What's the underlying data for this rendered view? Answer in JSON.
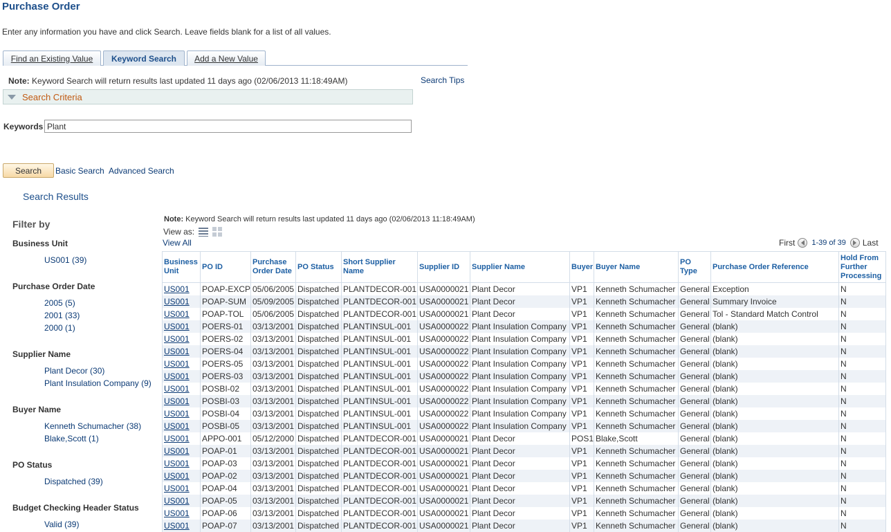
{
  "page": {
    "title": "Purchase Order",
    "instructions": "Enter any information you have and click Search. Leave fields blank for a list of all values."
  },
  "tabs": [
    {
      "label": "Find an Existing Value"
    },
    {
      "label": "Keyword Search"
    },
    {
      "label": "Add a New Value"
    }
  ],
  "note": {
    "label": "Note:",
    "text": "Keyword Search will return results last updated 11 days ago (02/06/2013 11:18:49AM)"
  },
  "search_tips": "Search Tips",
  "criteria": {
    "label": "Search Criteria"
  },
  "keywords": {
    "label": "Keywords",
    "value": "Plant"
  },
  "buttons": {
    "search": "Search",
    "basic_search": "Basic Search",
    "advanced_search": "Advanced Search"
  },
  "results": {
    "title": "Search Results",
    "note_label": "Note:",
    "note_text": "Keyword Search will return results last updated 11 days ago (02/06/2013 11:18:49AM)",
    "view_as": "View as:",
    "view_all": "View All",
    "pager": {
      "first": "First",
      "range": "1-39 of 39",
      "last": "Last"
    },
    "columns": [
      "Business Unit",
      "PO ID",
      "Purchase Order Date",
      "PO Status",
      "Short Supplier Name",
      "Supplier ID",
      "Supplier Name",
      "Buyer",
      "Buyer Name",
      "PO Type",
      "Purchase Order Reference",
      "Hold From Further Processing"
    ],
    "rows": [
      [
        "US001",
        "POAP-EXCP",
        "05/06/2005",
        "Dispatched",
        "PLANTDECOR-001",
        "USA0000021",
        "Plant Decor",
        "VP1",
        "Kenneth Schumacher",
        "General",
        "Exception",
        "N"
      ],
      [
        "US001",
        "POAP-SUM",
        "05/09/2005",
        "Dispatched",
        "PLANTDECOR-001",
        "USA0000021",
        "Plant Decor",
        "VP1",
        "Kenneth Schumacher",
        "General",
        "Summary Invoice",
        "N"
      ],
      [
        "US001",
        "POAP-TOL",
        "05/06/2005",
        "Dispatched",
        "PLANTDECOR-001",
        "USA0000021",
        "Plant Decor",
        "VP1",
        "Kenneth Schumacher",
        "General",
        "Tol - Standard Match Control",
        "N"
      ],
      [
        "US001",
        "POERS-01",
        "03/13/2001",
        "Dispatched",
        "PLANTINSUL-001",
        "USA0000022",
        "Plant Insulation Company",
        "VP1",
        "Kenneth Schumacher",
        "General",
        "(blank)",
        "N"
      ],
      [
        "US001",
        "POERS-02",
        "03/13/2001",
        "Dispatched",
        "PLANTINSUL-001",
        "USA0000022",
        "Plant Insulation Company",
        "VP1",
        "Kenneth Schumacher",
        "General",
        "(blank)",
        "N"
      ],
      [
        "US001",
        "POERS-04",
        "03/13/2001",
        "Dispatched",
        "PLANTINSUL-001",
        "USA0000022",
        "Plant Insulation Company",
        "VP1",
        "Kenneth Schumacher",
        "General",
        "(blank)",
        "N"
      ],
      [
        "US001",
        "POERS-05",
        "03/13/2001",
        "Dispatched",
        "PLANTINSUL-001",
        "USA0000022",
        "Plant Insulation Company",
        "VP1",
        "Kenneth Schumacher",
        "General",
        "(blank)",
        "N"
      ],
      [
        "US001",
        "POERS-03",
        "03/13/2001",
        "Dispatched",
        "PLANTINSUL-001",
        "USA0000022",
        "Plant Insulation Company",
        "VP1",
        "Kenneth Schumacher",
        "General",
        "(blank)",
        "N"
      ],
      [
        "US001",
        "POSBI-02",
        "03/13/2001",
        "Dispatched",
        "PLANTINSUL-001",
        "USA0000022",
        "Plant Insulation Company",
        "VP1",
        "Kenneth Schumacher",
        "General",
        "(blank)",
        "N"
      ],
      [
        "US001",
        "POSBI-03",
        "03/13/2001",
        "Dispatched",
        "PLANTINSUL-001",
        "USA0000022",
        "Plant Insulation Company",
        "VP1",
        "Kenneth Schumacher",
        "General",
        "(blank)",
        "N"
      ],
      [
        "US001",
        "POSBI-04",
        "03/13/2001",
        "Dispatched",
        "PLANTINSUL-001",
        "USA0000022",
        "Plant Insulation Company",
        "VP1",
        "Kenneth Schumacher",
        "General",
        "(blank)",
        "N"
      ],
      [
        "US001",
        "POSBI-05",
        "03/13/2001",
        "Dispatched",
        "PLANTINSUL-001",
        "USA0000022",
        "Plant Insulation Company",
        "VP1",
        "Kenneth Schumacher",
        "General",
        "(blank)",
        "N"
      ],
      [
        "US001",
        "APPO-001",
        "05/12/2000",
        "Dispatched",
        "PLANTDECOR-001",
        "USA0000021",
        "Plant Decor",
        "POS1",
        "Blake,Scott",
        "General",
        "(blank)",
        "N"
      ],
      [
        "US001",
        "POAP-01",
        "03/13/2001",
        "Dispatched",
        "PLANTDECOR-001",
        "USA0000021",
        "Plant Decor",
        "VP1",
        "Kenneth Schumacher",
        "General",
        "(blank)",
        "N"
      ],
      [
        "US001",
        "POAP-03",
        "03/13/2001",
        "Dispatched",
        "PLANTDECOR-001",
        "USA0000021",
        "Plant Decor",
        "VP1",
        "Kenneth Schumacher",
        "General",
        "(blank)",
        "N"
      ],
      [
        "US001",
        "POAP-02",
        "03/13/2001",
        "Dispatched",
        "PLANTDECOR-001",
        "USA0000021",
        "Plant Decor",
        "VP1",
        "Kenneth Schumacher",
        "General",
        "(blank)",
        "N"
      ],
      [
        "US001",
        "POAP-04",
        "03/13/2001",
        "Dispatched",
        "PLANTDECOR-001",
        "USA0000021",
        "Plant Decor",
        "VP1",
        "Kenneth Schumacher",
        "General",
        "(blank)",
        "N"
      ],
      [
        "US001",
        "POAP-05",
        "03/13/2001",
        "Dispatched",
        "PLANTDECOR-001",
        "USA0000021",
        "Plant Decor",
        "VP1",
        "Kenneth Schumacher",
        "General",
        "(blank)",
        "N"
      ],
      [
        "US001",
        "POAP-06",
        "03/13/2001",
        "Dispatched",
        "PLANTDECOR-001",
        "USA0000021",
        "Plant Decor",
        "VP1",
        "Kenneth Schumacher",
        "General",
        "(blank)",
        "N"
      ],
      [
        "US001",
        "POAP-07",
        "03/13/2001",
        "Dispatched",
        "PLANTDECOR-001",
        "USA0000021",
        "Plant Decor",
        "VP1",
        "Kenneth Schumacher",
        "General",
        "(blank)",
        "N"
      ]
    ]
  },
  "filters": {
    "title": "Filter by",
    "groups": [
      {
        "heading": "Business Unit",
        "items": [
          "US001 (39)"
        ]
      },
      {
        "heading": "Purchase Order Date",
        "items": [
          "2005 (5)",
          "2001 (33)",
          "2000 (1)"
        ]
      },
      {
        "heading": "Supplier Name",
        "items": [
          "Plant Decor (30)",
          "Plant Insulation Company (9)"
        ]
      },
      {
        "heading": "Buyer Name",
        "items": [
          "Kenneth Schumacher (38)",
          "Blake,Scott (1)"
        ]
      },
      {
        "heading": "PO Status",
        "items": [
          "Dispatched (39)"
        ]
      },
      {
        "heading": "Budget Checking Header Status",
        "items": [
          "Valid (39)"
        ]
      }
    ]
  },
  "colors": {
    "link": "#0b3a75",
    "title": "#1d4f8b",
    "criteria": "#c15a12",
    "row_alt": "#eef2f7"
  },
  "icons": [
    "list-view-icon",
    "grid-view-icon",
    "previous-icon",
    "next-icon",
    "collapse-triangle-icon"
  ]
}
